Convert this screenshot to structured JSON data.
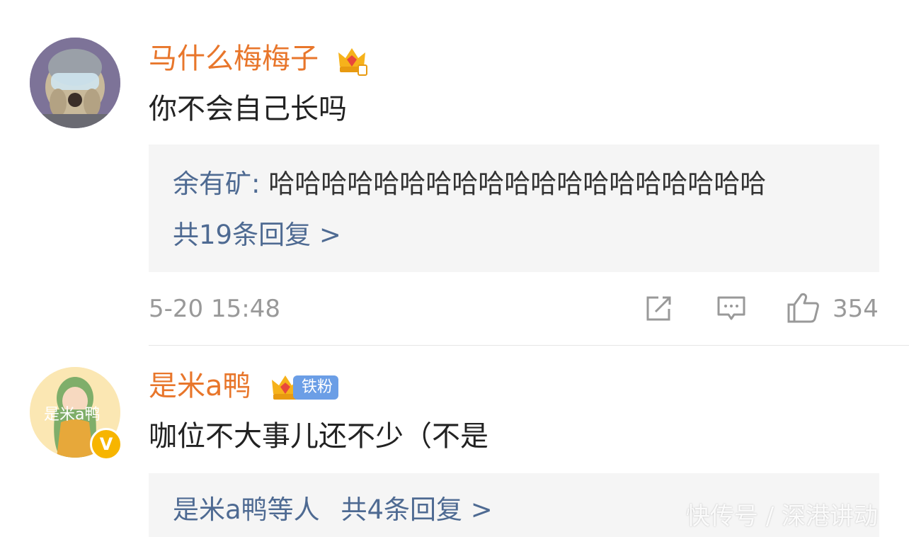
{
  "comments": [
    {
      "username": "马什么梅梅子",
      "text": "你不会自己长吗",
      "reply_preview": {
        "author": "余有矿:",
        "text": " 哈哈哈哈哈哈哈哈哈哈哈哈哈哈哈哈哈哈哈"
      },
      "reply_count_label": "共19条回复 >",
      "timestamp": "5-20 15:48",
      "likes": "354",
      "badges": [
        "crown-icon"
      ]
    },
    {
      "username": "是米a鸭",
      "text": "咖位不大事儿还不少（不是",
      "fan_badge": "铁粉",
      "verified_badge": "V",
      "reply_summary": {
        "authors": "是米a鸭等人",
        "count_label": "共4条回复 >"
      },
      "badges": [
        "crown-icon",
        "verified-icon"
      ]
    }
  ],
  "watermark": "快传号 / 深港讲动",
  "colors": {
    "username": "#e8762b",
    "link": "#4e6a92",
    "reply_bg": "#f5f5f5",
    "meta": "#999999",
    "fan_badge": "#6b9ee6",
    "verified": "#f7b500"
  }
}
